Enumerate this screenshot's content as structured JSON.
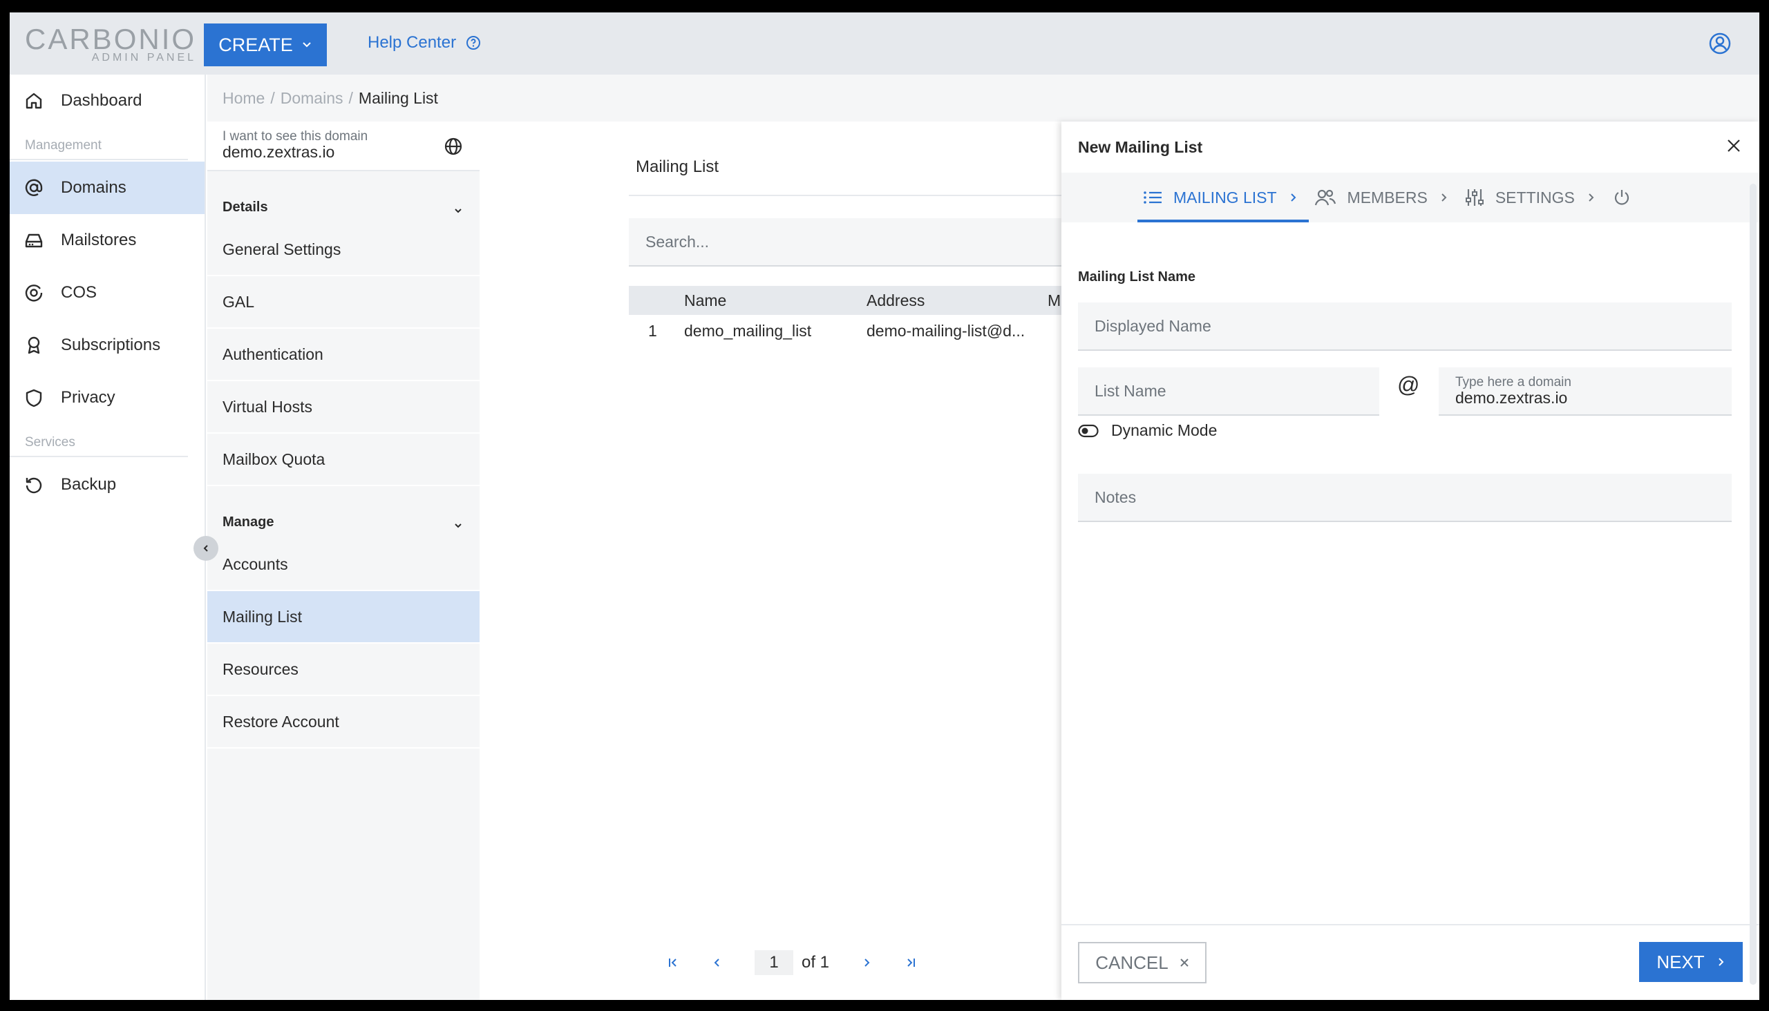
{
  "header": {
    "logo_main": "CARBONIO",
    "logo_sub": "ADMIN PANEL",
    "create_label": "CREATE",
    "help_label": "Help Center"
  },
  "leftnav": {
    "dashboard": "Dashboard",
    "management_label": "Management",
    "domains": "Domains",
    "mailstores": "Mailstores",
    "cos": "COS",
    "subscriptions": "Subscriptions",
    "privacy": "Privacy",
    "services_label": "Services",
    "backup": "Backup"
  },
  "breadcrumb": {
    "home": "Home",
    "sep1": "/",
    "domains": "Domains",
    "sep2": "/",
    "current": "Mailing List"
  },
  "subnav": {
    "domain_hint": "I want to see this domain",
    "domain_value": "demo.zextras.io",
    "details_label": "Details",
    "details_items": [
      "General Settings",
      "GAL",
      "Authentication",
      "Virtual Hosts",
      "Mailbox Quota"
    ],
    "manage_label": "Manage",
    "manage_items": [
      "Accounts",
      "Mailing List",
      "Resources",
      "Restore Account"
    ]
  },
  "list": {
    "title": "Mailing List",
    "search_placeholder": "Search...",
    "columns": [
      "Name",
      "Address",
      "M"
    ],
    "rows": [
      {
        "index": "1",
        "name": "demo_mailing_list",
        "address": "demo-mailing-list@d..."
      }
    ],
    "pager": {
      "page": "1",
      "of": "of 1"
    }
  },
  "panel": {
    "title": "New Mailing List",
    "steps": [
      "MAILING LIST",
      "MEMBERS",
      "SETTINGS"
    ],
    "section_label": "Mailing List Name",
    "displayed_name_placeholder": "Displayed Name",
    "list_name_placeholder": "List Name",
    "at_sign": "@",
    "domain_hint": "Type here a domain",
    "domain_value": "demo.zextras.io",
    "dynamic_mode": "Dynamic Mode",
    "notes_placeholder": "Notes",
    "cancel_label": "CANCEL",
    "next_label": "NEXT"
  },
  "colors": {
    "accent": "#2b73d2",
    "active_bg": "#d5e3f6",
    "muted_bg": "#f5f6f7",
    "header_bg": "#e6e9ed"
  }
}
